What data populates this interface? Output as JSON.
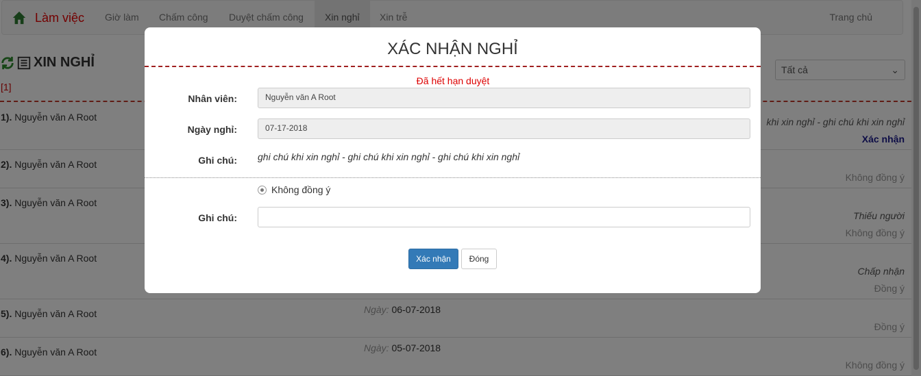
{
  "navbar": {
    "brand": "Làm việc",
    "items": [
      {
        "label": "Giờ làm"
      },
      {
        "label": "Chấm công"
      },
      {
        "label": "Duyệt chấm công"
      },
      {
        "label": "Xin nghỉ"
      },
      {
        "label": "Xin trễ"
      }
    ],
    "active_item": "Xin nghỉ",
    "home": "Trang chủ"
  },
  "page": {
    "title": "XIN NGHỈ",
    "count": "[1]",
    "filter_selected": "Tất cả"
  },
  "rows": [
    {
      "name_prefix": "1).",
      "name": "Nguyễn văn A Root",
      "right_italic": "khi xin nghỉ - ghi chú khi xin nghỉ",
      "right_action": "Xác nhận"
    },
    {
      "name_prefix": "2).",
      "name": "Nguyễn văn A Root",
      "right_status": "Không đồng ý"
    },
    {
      "name_prefix": "3).",
      "name": "Nguyễn văn A Root",
      "right_italic": "Thiếu người",
      "right_status": "Không đồng ý"
    },
    {
      "name_prefix": "4).",
      "name": "Nguyễn văn A Root",
      "right_italic": "Chấp nhận",
      "right_status": "Đồng ý"
    },
    {
      "name_prefix": "5).",
      "name": "Nguyễn văn A Root",
      "date_label": "Ngày:",
      "date": "06-07-2018",
      "right_status": "Đồng ý"
    },
    {
      "name_prefix": "6).",
      "name": "Nguyễn văn A Root",
      "date_label": "Ngày:",
      "date": "05-07-2018",
      "right_status": "Không đồng ý"
    }
  ],
  "modal": {
    "title": "XÁC NHẬN NGHỈ",
    "expired_notice": "Đã hết hạn duyệt",
    "employee_label": "Nhân viên:",
    "employee_value": "Nguyễn văn A Root",
    "date_label": "Ngày nghỉ:",
    "date_value": "07-17-2018",
    "note_label": "Ghi chú:",
    "note_value": "ghi chú khi xin nghỉ - ghi chú khi xin nghỉ - ghi chú khi xin nghỉ",
    "radio_label": "Không đồng ý",
    "reply_note_label": "Ghi chú:",
    "reply_note_value": "",
    "confirm_button": "Xác nhận",
    "close_button": "Đóng"
  },
  "colors": {
    "brand": "#e60000",
    "primary": "#337ab7",
    "expired": "#dd0000",
    "divider": "#a02020"
  }
}
